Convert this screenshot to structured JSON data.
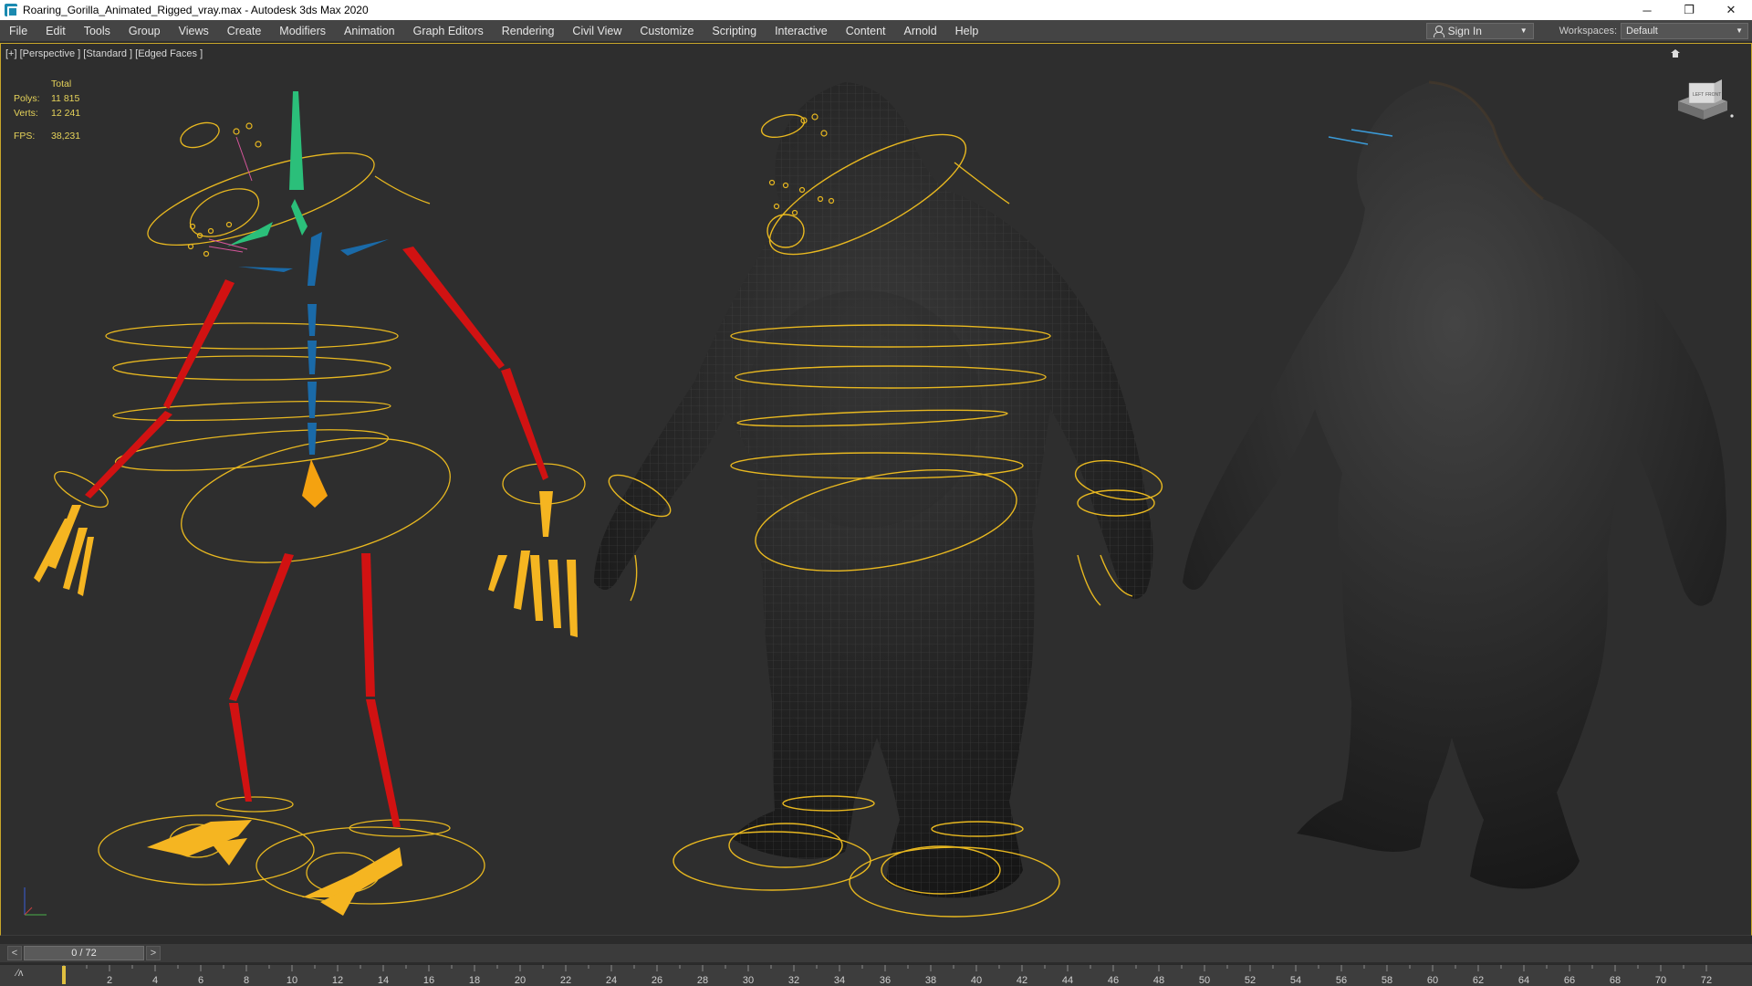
{
  "window": {
    "title": "Roaring_Gorilla_Animated_Rigged_vray.max - Autodesk 3ds Max 2020",
    "minimize": "─",
    "maximize": "❐",
    "close": "✕"
  },
  "menubar": {
    "items": [
      "File",
      "Edit",
      "Tools",
      "Group",
      "Views",
      "Create",
      "Modifiers",
      "Animation",
      "Graph Editors",
      "Rendering",
      "Civil View",
      "Customize",
      "Scripting",
      "Interactive",
      "Content",
      "Arnold",
      "Help"
    ],
    "signin_label": "Sign In",
    "workspaces_label": "Workspaces:",
    "workspace_value": "Default"
  },
  "viewport": {
    "label": "[+] [Perspective ] [Standard ] [Edged Faces ]",
    "stats": {
      "total_label": "Total",
      "polys_label": "Polys:",
      "polys_value": "11 815",
      "verts_label": "Verts:",
      "verts_value": "12 241",
      "fps_label": "FPS:",
      "fps_value": "38,231"
    },
    "viewcube_left": "LEFT",
    "viewcube_front": "FRONT"
  },
  "timeline": {
    "prev": "<",
    "next": ">",
    "frame_display": "0 / 72",
    "current_frame": 0,
    "total_frames": 72,
    "tick_labels": [
      "2",
      "4",
      "6",
      "8",
      "10",
      "12",
      "14",
      "16",
      "18",
      "20",
      "22",
      "24",
      "26",
      "28",
      "30",
      "32",
      "34",
      "36",
      "38",
      "40",
      "42",
      "44",
      "46",
      "48",
      "50",
      "52",
      "54",
      "56",
      "58",
      "60",
      "62",
      "64",
      "66",
      "68",
      "70",
      "72"
    ]
  },
  "colors": {
    "accent_yellow": "#e8b820",
    "bone_red": "#d11212",
    "bone_blue": "#1a6aa8",
    "bone_green": "#2bbf7a",
    "gorilla_fur": "#1f1f1f"
  },
  "icons": {
    "app": "3dsmax-app-icon",
    "user": "user-icon",
    "home": "home-icon",
    "curve": "curve-editor-icon"
  }
}
